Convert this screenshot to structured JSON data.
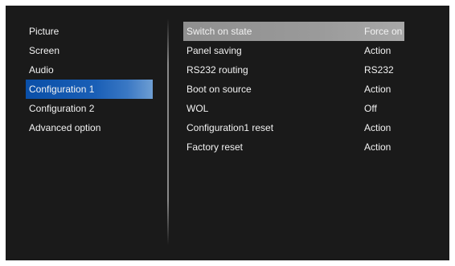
{
  "left_menu": [
    {
      "label": "Picture"
    },
    {
      "label": "Screen"
    },
    {
      "label": "Audio"
    },
    {
      "label": "Configuration 1"
    },
    {
      "label": "Configuration 2"
    },
    {
      "label": "Advanced option"
    }
  ],
  "selected_category": "Configuration 1",
  "settings": [
    {
      "label": "Switch on state",
      "value": "Force on"
    },
    {
      "label": "Panel saving",
      "value": "Action"
    },
    {
      "label": "RS232 routing",
      "value": "RS232"
    },
    {
      "label": "Boot on source",
      "value": "Action"
    },
    {
      "label": "WOL",
      "value": "Off"
    },
    {
      "label": "Configuration1 reset",
      "value": "Action"
    },
    {
      "label": "Factory reset",
      "value": "Action"
    }
  ],
  "selected_setting": "Switch on state",
  "colors": {
    "background": "#1a1a1a",
    "selected_category": "#1a5fb6",
    "selected_setting": "#9a9a9a",
    "text": "#f2f2f2"
  }
}
